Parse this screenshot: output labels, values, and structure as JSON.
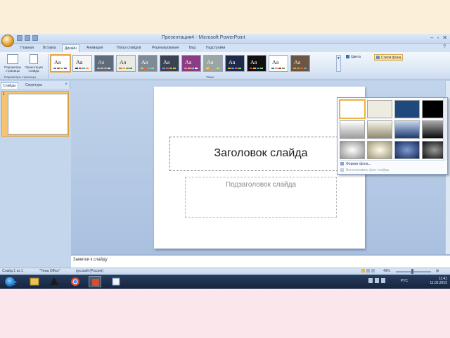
{
  "window": {
    "title": "Презентация4 - Microsoft PowerPoint",
    "controls": [
      "–",
      "▫",
      "✕"
    ]
  },
  "ribbon": {
    "tabs": [
      {
        "label": "Главная",
        "active": false
      },
      {
        "label": "Вставка",
        "active": false
      },
      {
        "label": "Дизайн",
        "active": true
      },
      {
        "label": "Анимация",
        "active": false
      },
      {
        "label": "Показ слайдов",
        "active": false
      },
      {
        "label": "Рецензирование",
        "active": false
      },
      {
        "label": "Вид",
        "active": false
      },
      {
        "label": "Надстройки",
        "active": false
      }
    ],
    "help": "?",
    "page_setup": {
      "buttons": [
        "Параметры страницы",
        "Ориентация слайда"
      ],
      "group_label": "Параметры страницы"
    },
    "themes": {
      "group_label": "Темы",
      "sample_text": "Aa",
      "items": [
        {
          "bg": "#ffffff",
          "fg": "#222222",
          "bars": [
            "#4f81bd",
            "#c0504d",
            "#9bbb59",
            "#8064a2"
          ]
        },
        {
          "bg": "#f5f5f5",
          "fg": "#111111",
          "bars": [
            "#1f497d",
            "#c0504d",
            "#4bacc6",
            "#f79646"
          ]
        },
        {
          "bg": "#5e6b7a",
          "fg": "#dde3ea",
          "bars": [
            "#9fb7d3",
            "#d8c27c",
            "#b5a3c9",
            "#e2e2e2"
          ]
        },
        {
          "bg": "#eaeae4",
          "fg": "#3a3a3a",
          "bars": [
            "#d56f3c",
            "#e2a54b",
            "#7e9a3f",
            "#5b7aa6"
          ]
        },
        {
          "bg": "#7d8a98",
          "fg": "#ffffff",
          "bars": [
            "#f2c14e",
            "#e86b3a",
            "#6fb8d6",
            "#b4d36b"
          ]
        },
        {
          "bg": "#3a4353",
          "fg": "#ffffff",
          "bars": [
            "#6f9fd8",
            "#d9665b",
            "#9ac46b",
            "#e0b94a"
          ]
        },
        {
          "bg": "#8b3c82",
          "fg": "#ffffff",
          "bars": [
            "#e57ec4",
            "#f0c36b",
            "#7bc3e0",
            "#ffffff"
          ]
        },
        {
          "bg": "#9aa6a4",
          "fg": "#ffffff",
          "bars": [
            "#f7d154",
            "#ef8a48",
            "#6bb3d6",
            "#c6e07a"
          ]
        },
        {
          "bg": "#1d2a4a",
          "fg": "#ffffff",
          "bars": [
            "#f2a93b",
            "#5aa2e0",
            "#d95b5b",
            "#8fcf6a"
          ]
        },
        {
          "bg": "#101010",
          "fg": "#ffffff",
          "bars": [
            "#e03c3c",
            "#f5b83d",
            "#3b9be0",
            "#7bd160"
          ]
        },
        {
          "bg": "#ffffff",
          "fg": "#2a2a2a",
          "bars": [
            "#3b6fb6",
            "#e0a33b",
            "#9b3b3b",
            "#5aa05a"
          ]
        },
        {
          "bg": "#6d5544",
          "fg": "#f7e7cf",
          "bars": [
            "#d9a23b",
            "#8ab56b",
            "#c8643a",
            "#6aa5c4"
          ]
        }
      ],
      "more": "▼"
    },
    "colors_button": "Цвета",
    "background_styles_button": "Стили фона"
  },
  "left_panel": {
    "tabs": [
      "Слайды",
      "Структура"
    ],
    "active_tab": 0,
    "close": "×",
    "slide_number": "1"
  },
  "slide": {
    "title_placeholder": "Заголовок слайда",
    "subtitle_placeholder": "Подзаголовок слайда"
  },
  "notes": {
    "placeholder": "Заметки к слайду"
  },
  "status": {
    "slide_info": "Слайд 1 из 1",
    "theme_name": "\"Тема Office\"",
    "language": "русский (Россия)",
    "zoom": "49%"
  },
  "taskbar": {
    "apps": [
      "ie-icon",
      "explorer-icon",
      "wizard-icon",
      "chrome-icon",
      "powerpoint-icon",
      "screenshot-icon"
    ],
    "active_app": 4,
    "language": "РУС",
    "time": "11:41",
    "date": "11.02.2015"
  },
  "background_styles_dropdown": {
    "styles": [
      {
        "fill": "#ffffff",
        "selected": true
      },
      {
        "fill": "#eeece1",
        "selected": false
      },
      {
        "fill": "#1f497d",
        "selected": false
      },
      {
        "fill": "#000000",
        "selected": false
      },
      {
        "fill": "linear-gradient(#ffffff,#9d9d9d)",
        "selected": false
      },
      {
        "fill": "linear-gradient(#f7f5ea,#8f8a70)",
        "selected": false
      },
      {
        "fill": "linear-gradient(#c9d6ec,#1c3972)",
        "selected": false
      },
      {
        "fill": "linear-gradient(#a8a8a8,#0a0a0a)",
        "selected": false
      },
      {
        "fill": "radial-gradient(#ffffff,#8e8e8e)",
        "selected": false
      },
      {
        "fill": "radial-gradient(#fffbe8,#9b9575)",
        "selected": false
      },
      {
        "fill": "radial-gradient(#7f9ad0,#13295a)",
        "selected": false
      },
      {
        "fill": "radial-gradient(#9a9a9a,#0c0c0c)",
        "selected": false
      }
    ],
    "format_background": "Формат фона...",
    "reset_background": "Восстановить фон слайда"
  }
}
